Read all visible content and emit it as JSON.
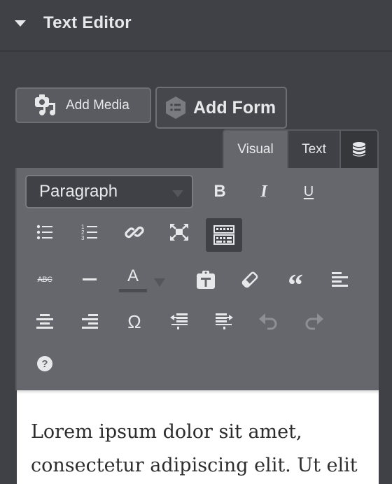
{
  "panel": {
    "section_title": "Text Editor",
    "collapse_icon": "caret-down-icon"
  },
  "media_buttons": {
    "add_media": {
      "label": "Add Media",
      "icon": "camera-music-icon"
    },
    "add_form": {
      "label": "Add Form",
      "icon": "form-list-icon"
    }
  },
  "editor_tabs": [
    {
      "label": "Visual",
      "active": true
    },
    {
      "label": "Text",
      "active": false
    },
    {
      "label": "",
      "icon": "database-icon",
      "active": false
    }
  ],
  "toolbar": {
    "format_select": {
      "value": "Paragraph"
    },
    "buttons": [
      {
        "name": "bold",
        "glyph": "B"
      },
      {
        "name": "italic",
        "glyph": "I"
      },
      {
        "name": "underline",
        "glyph": "U"
      },
      {
        "name": "bulleted-list"
      },
      {
        "name": "numbered-list"
      },
      {
        "name": "insert-link"
      },
      {
        "name": "fullscreen"
      },
      {
        "name": "toolbar-toggle",
        "active": true
      },
      {
        "name": "strikethrough",
        "glyph": "ABC"
      },
      {
        "name": "horizontal-line"
      },
      {
        "name": "text-color",
        "glyph": "A"
      },
      {
        "name": "paste-as-text"
      },
      {
        "name": "clear-formatting"
      },
      {
        "name": "blockquote",
        "glyph": "“"
      },
      {
        "name": "align-left"
      },
      {
        "name": "align-center"
      },
      {
        "name": "align-right"
      },
      {
        "name": "special-character",
        "glyph": "Ω"
      },
      {
        "name": "outdent"
      },
      {
        "name": "indent"
      },
      {
        "name": "undo",
        "disabled": true
      },
      {
        "name": "redo",
        "disabled": true
      },
      {
        "name": "keyboard-shortcuts-help",
        "glyph": "?"
      }
    ]
  },
  "editor": {
    "content": "Lorem ipsum dolor sit amet, consectetur adipiscing elit. Ut elit"
  },
  "colors": {
    "panel_bg": "#404146",
    "toolbar_bg": "#66676c",
    "text_light": "#e6e8ea",
    "editor_bg": "#ffffff"
  }
}
